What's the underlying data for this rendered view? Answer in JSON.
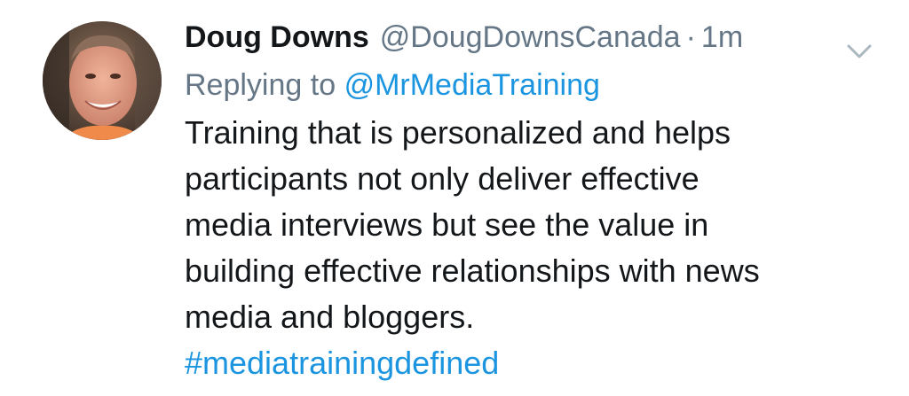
{
  "tweet": {
    "author_name": "Doug Downs",
    "author_handle": "@DougDownsCanada",
    "separator": "·",
    "timestamp": "1m",
    "menu_icon": "chevron-down-icon",
    "avatar_icon": "avatar-photo",
    "reply": {
      "prefix": "Replying to",
      "handle": "@MrMediaTraining"
    },
    "body_lines": [
      "Training that is personalized and helps",
      "participants not only deliver effective",
      "media interviews but see the value in",
      "building effective relationships with news",
      "media and bloggers."
    ],
    "hashtag": "#mediatrainingdefined"
  },
  "colors": {
    "text_primary": "#14171a",
    "text_secondary": "#657786",
    "link": "#1b95e0",
    "background": "#ffffff"
  }
}
